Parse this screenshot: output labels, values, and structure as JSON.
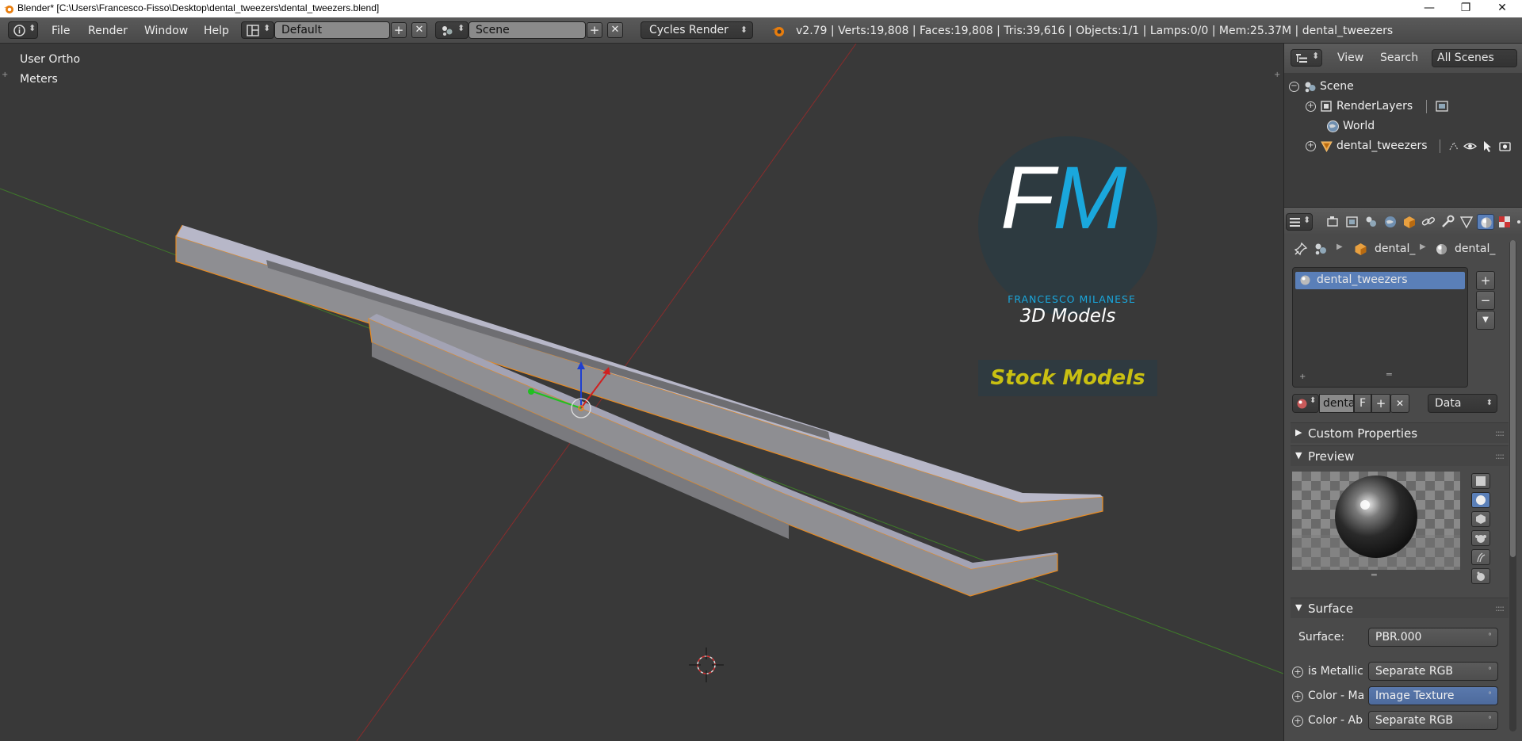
{
  "window": {
    "title": "Blender* [C:\\Users\\Francesco-Fisso\\Desktop\\dental_tweezers\\dental_tweezers.blend]",
    "min_glyph": "—",
    "max_glyph": "❐",
    "close_glyph": "✕"
  },
  "header": {
    "menus": [
      "File",
      "Render",
      "Window",
      "Help"
    ],
    "layout": "Default",
    "scene": "Scene",
    "engine": "Cycles Render",
    "stats": "v2.79 | Verts:19,808 | Faces:19,808 | Tris:39,616 | Objects:1/1 | Lamps:0/0 | Mem:25.37M | dental_tweezers",
    "plus_glyph": "+",
    "x_glyph": "✕",
    "updown_glyph": "⬍"
  },
  "viewport": {
    "view_name": "User Ortho",
    "units": "Meters"
  },
  "watermark": {
    "letter_f": "F",
    "letter_m": "M",
    "name": "FRANCESCO MILANESE",
    "subtitle": "3D Models",
    "badge": "Stock Models",
    "colors": {
      "accent": "#1aa7dc",
      "badge_text": "#c9c012",
      "badge_bg": "#2f3a40"
    }
  },
  "outliner": {
    "menus": [
      "View",
      "Search"
    ],
    "filter": "All Scenes",
    "items": [
      {
        "label": "Scene",
        "expander": "−"
      },
      {
        "label": "RenderLayers",
        "expander": "+"
      },
      {
        "label": "World",
        "expander": ""
      },
      {
        "label": "dental_tweezers",
        "expander": "+"
      }
    ]
  },
  "properties": {
    "breadcrumb": [
      "dental_",
      "dental_"
    ],
    "material_slot": "dental_tweezers",
    "datablock_name": "denta",
    "datablock_f": "F",
    "link_mode": "Data",
    "panels": {
      "custom_properties": "Custom Properties",
      "preview": "Preview",
      "surface": "Surface"
    },
    "surface": {
      "label": "Surface:",
      "value": "PBR.000",
      "inputs": [
        {
          "label": "is Metallic",
          "value": "Separate RGB"
        },
        {
          "label": "Color - Ma",
          "value": "Image Texture"
        },
        {
          "label": "Color - Ab",
          "value": "Separate RGB"
        }
      ]
    },
    "glyphs": {
      "plus": "+",
      "minus": "−",
      "down": "▼",
      "right": "▶",
      "grip": "::::",
      "dot": "°",
      "x": "✕"
    }
  }
}
